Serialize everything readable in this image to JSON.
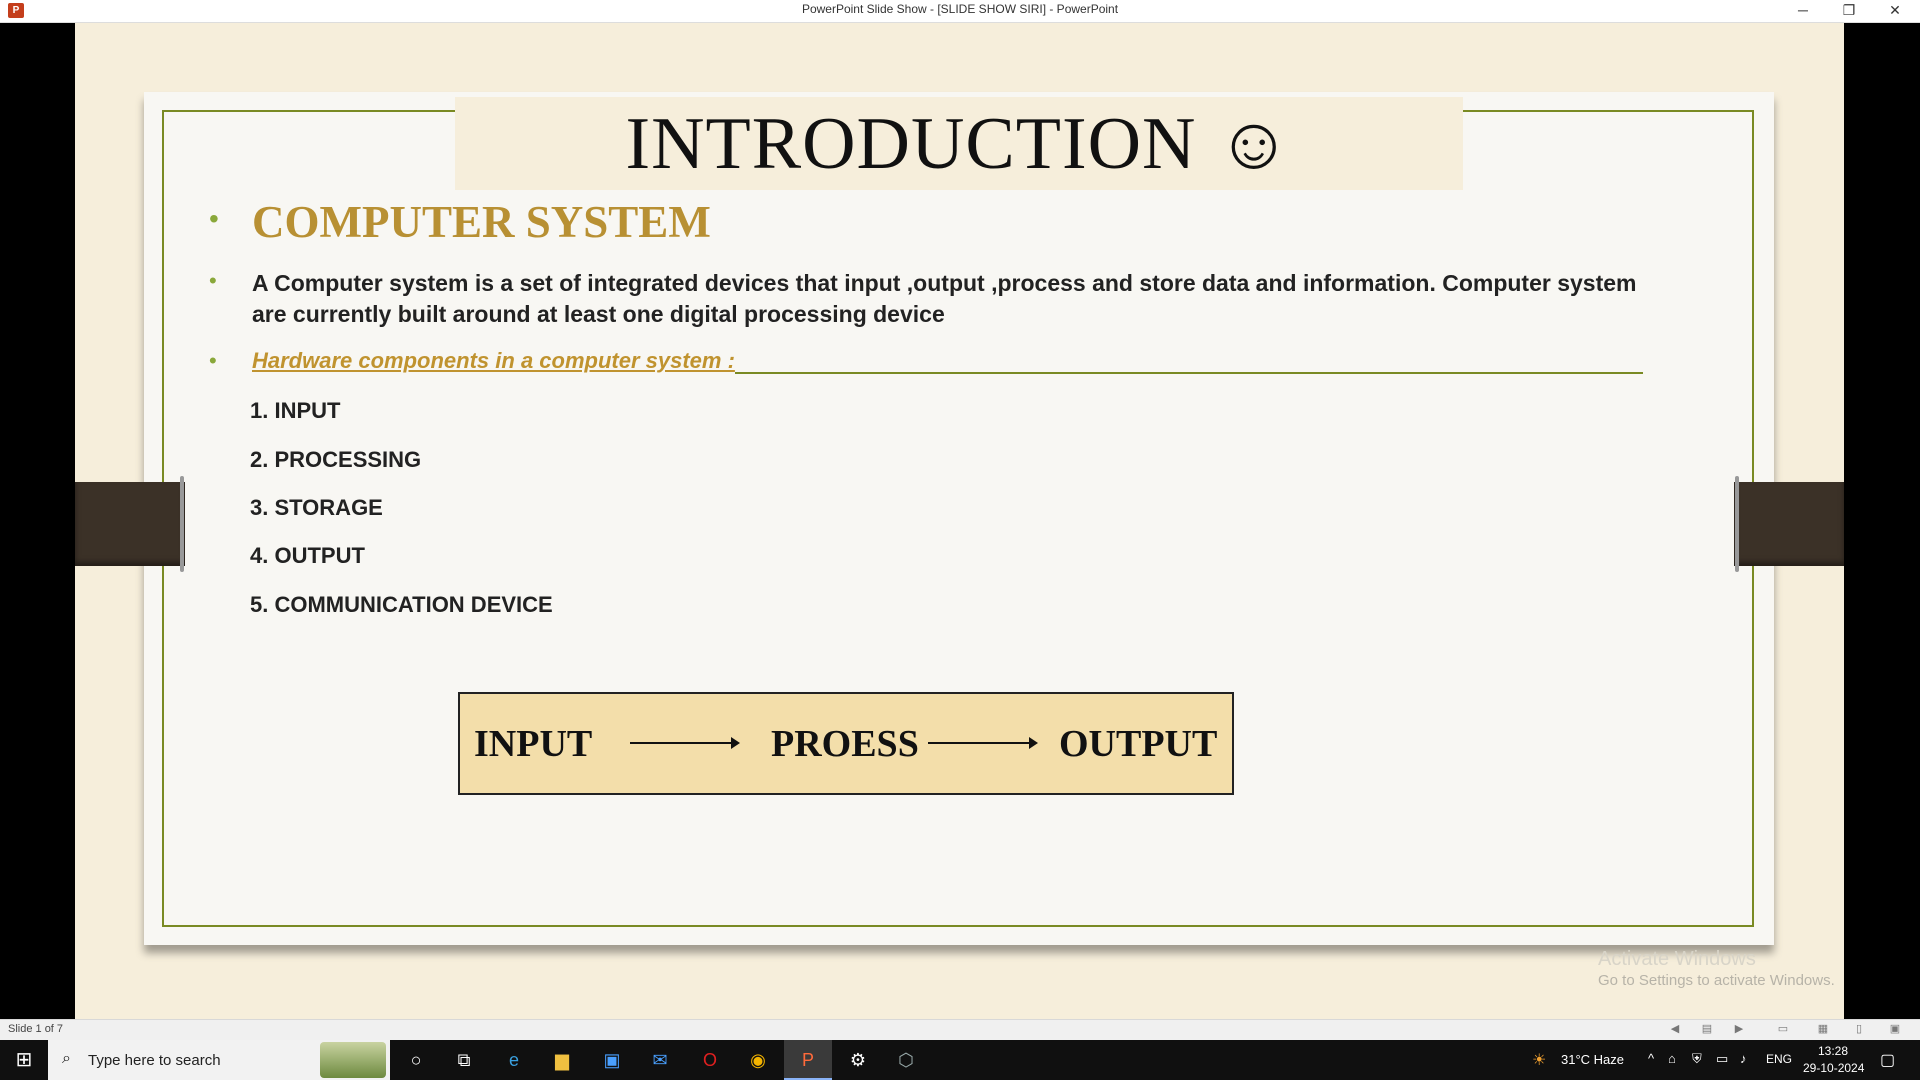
{
  "window": {
    "title": "PowerPoint Slide Show - [SLIDE SHOW SIRI] - PowerPoint",
    "app_icon": "P",
    "minimize": "─",
    "restore": "❐",
    "close": "✕"
  },
  "slide": {
    "title": "INTRODUCTION ☺",
    "heading": "COMPUTER SYSTEM",
    "paragraph": "A Computer system is a set of integrated devices that input ,output ,process and store data and information. Computer system are currently built around at least one digital processing device",
    "subheading": "Hardware components in a computer system :",
    "list": [
      "1. INPUT",
      "2. PROCESSING",
      "3. STORAGE",
      "4. OUTPUT",
      "5. COMMUNICATION DEVICE"
    ],
    "flow": [
      "INPUT",
      "PROESS",
      "OUTPUT"
    ],
    "bullet_color": "#8aa83a",
    "heading_color": "#b89033"
  },
  "watermark": {
    "line1": "Activate Windows",
    "line2": "Go to Settings to activate Windows."
  },
  "statusbar": {
    "slide_indicator": "Slide 1 of 7"
  },
  "taskbar": {
    "search_placeholder": "Type here to search",
    "weather": "31°C  Haze",
    "language": "ENG",
    "time": "13:28",
    "date": "29-10-2024"
  }
}
